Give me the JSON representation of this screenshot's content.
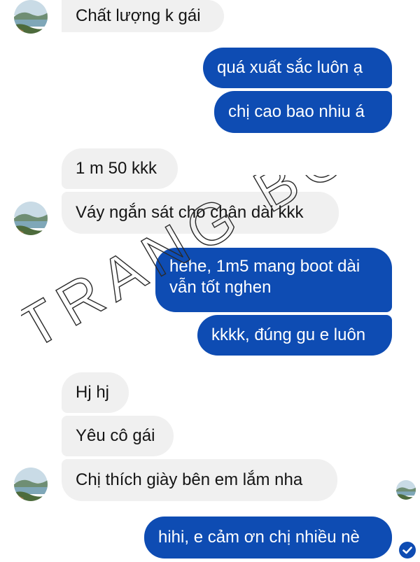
{
  "messages": [
    {
      "side": "in",
      "text": "Chất lượng k gái"
    },
    {
      "side": "out",
      "text": "quá xuất sắc luôn ạ"
    },
    {
      "side": "out",
      "text": "chị cao bao nhiu á"
    },
    {
      "side": "in",
      "text": "1 m 50 kkk"
    },
    {
      "side": "in",
      "text": "Váy ngắn sát cho chân dài kkk"
    },
    {
      "side": "out",
      "text": "hehe, 1m5 mang boot dài vẫn tốt nghen"
    },
    {
      "side": "out",
      "text": "kkkk, đúng gu e luôn"
    },
    {
      "side": "in",
      "text": "Hj hj"
    },
    {
      "side": "in",
      "text": "Yêu cô gái"
    },
    {
      "side": "in",
      "text": "Chị thích giày bên em lắm nha"
    },
    {
      "side": "out",
      "text": "hihi, e cảm ơn chị nhiều nè"
    }
  ],
  "watermark": {
    "text": "TRANG BOOTS"
  },
  "icons": {
    "contact_avatar": "landscape-avatar-icon",
    "seen_indicator": "seen-check-icon"
  },
  "colors": {
    "outgoing_bubble": "#0e4cb3",
    "incoming_bubble": "#f0f0f0"
  }
}
